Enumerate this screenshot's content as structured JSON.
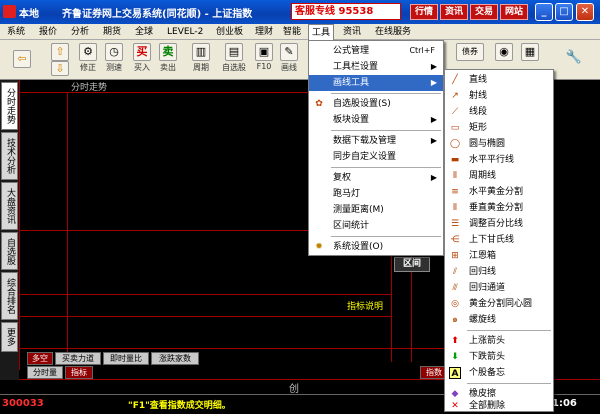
{
  "titlebar": {
    "app": "本地",
    "title": "齐鲁证券网上交易系统(同花顺) - 上证指数",
    "hotline": "客服专线 95538",
    "links": [
      "行情",
      "资讯",
      "交易",
      "网站"
    ]
  },
  "menubar": [
    "系统",
    "报价",
    "分析",
    "期货",
    "全球",
    "LEVEL-2",
    "创业板",
    "理财",
    "智能",
    "工具",
    "资讯",
    "在线服务"
  ],
  "toolbar": {
    "buttons": [
      "修正",
      "测速",
      "买入",
      "卖出",
      "周期",
      "自选股",
      "F10",
      "画线"
    ],
    "right_buttons": [
      "债券"
    ]
  },
  "left_tabs": [
    "分时走势",
    "技术分析",
    "大盘资讯",
    "自选股",
    "综合排名",
    "更多"
  ],
  "chart": {
    "title": "分时走势",
    "indicator_label": "指标说明",
    "interval_label": "区间",
    "bottom_mark": "创"
  },
  "bottom_tabs_row1": [
    "多空",
    "买卖力道",
    "即时量比",
    "涨跌家数"
  ],
  "bottom_tabs_row2": [
    "分时量",
    "指标"
  ],
  "bottom_right_tab": "指数",
  "status": {
    "code": "300033",
    "message": "\"F1\"查看指数成交明细。",
    "time": "1:06"
  },
  "tools_menu": {
    "items": [
      {
        "label": "公式管理",
        "shortcut": "Ctrl+F"
      },
      {
        "label": "工具栏设置",
        "submenu": true
      },
      {
        "label": "画线工具",
        "submenu": true,
        "highlighted": true
      },
      {
        "label": "自选股设置(S)"
      },
      {
        "label": "板块设置",
        "submenu": true
      },
      {
        "label": "数据下载及管理",
        "submenu": true
      },
      {
        "label": "同步自定义设置"
      },
      {
        "label": "复权",
        "submenu": true
      },
      {
        "label": "跑马灯"
      },
      {
        "label": "测量距离(M)"
      },
      {
        "label": "区间统计"
      },
      {
        "label": "系统设置(O)"
      }
    ]
  },
  "draw_menu": {
    "items": [
      "直线",
      "射线",
      "线段",
      "矩形",
      "圆与椭圆",
      "水平平行线",
      "周期线",
      "水平黄金分割",
      "垂直黄金分割",
      "调整百分比线",
      "上下甘氏线",
      "江恩箱",
      "回归线",
      "回归通道",
      "黄金分割同心圆",
      "螺旋线",
      "上涨箭头",
      "下跌箭头",
      "个股备忘",
      "橡皮擦",
      "全部删除"
    ]
  }
}
